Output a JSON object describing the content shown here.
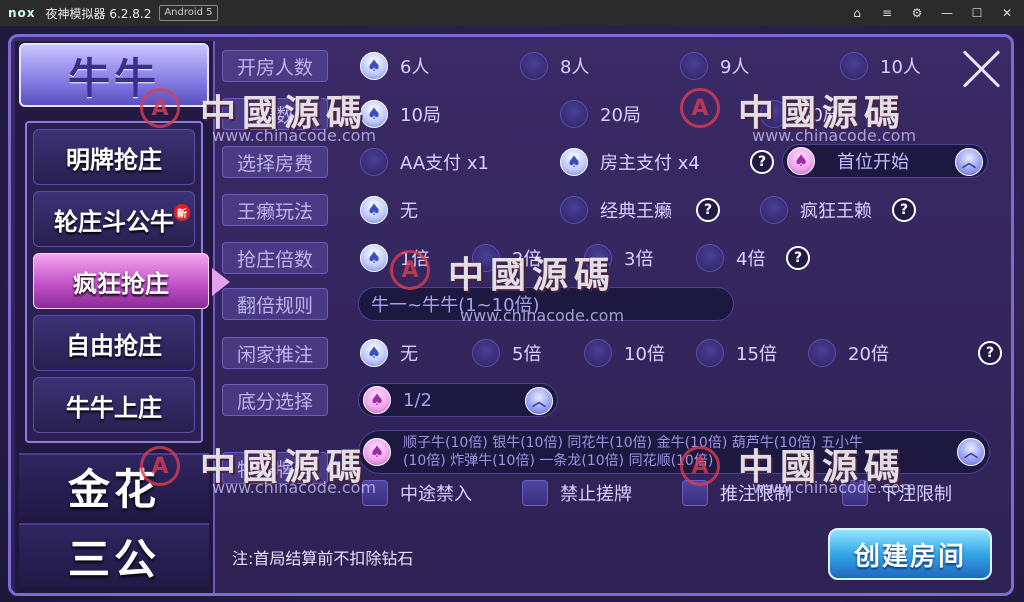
{
  "titlebar": {
    "logo": "nox",
    "title": "夜神模拟器 6.2.8.2",
    "android": "Android 5",
    "controls": [
      "⌂",
      "≡",
      "⚙",
      "—",
      "☐",
      "✕"
    ]
  },
  "left": {
    "big_tabs": [
      "牛牛",
      "金花",
      "三公"
    ],
    "sub_items": [
      "明牌抢庄",
      "轮庄斗公牛",
      "疯狂抢庄",
      "自由抢庄",
      "牛牛上庄"
    ],
    "new_badge": "新"
  },
  "rows": {
    "players": {
      "label": "开房人数",
      "options": [
        "6人",
        "8人",
        "9人",
        "10人"
      ]
    },
    "rounds": {
      "label": "局数",
      "options": [
        "10局",
        "20局",
        "30局"
      ]
    },
    "fee": {
      "label": "选择房费",
      "options": [
        "AA支付 x1",
        "房主支付 x4"
      ],
      "start_pill": "首位开始"
    },
    "wild": {
      "label": "王癞玩法",
      "options": [
        "无",
        "经典王癞",
        "疯狂王赖"
      ]
    },
    "grab": {
      "label": "抢庄倍数",
      "options": [
        "1倍",
        "2倍",
        "3倍",
        "4倍"
      ]
    },
    "double": {
      "label": "翻倍规则",
      "value": "牛一~牛牛(1~10倍)"
    },
    "push": {
      "label": "闲家推注",
      "options": [
        "无",
        "5倍",
        "10倍",
        "15倍",
        "20倍"
      ]
    },
    "base": {
      "label": "底分选择",
      "value": "1/2"
    },
    "special": {
      "label": "特殊牌型",
      "value_line1": "顺子牛(10倍)  银牛(10倍)  同花牛(10倍)  金牛(10倍)  葫芦牛(10倍)  五小牛",
      "value_line2": "(10倍)  炸弹牛(10倍)  一条龙(10倍)  同花顺(10倍)"
    },
    "checks": [
      "中途禁入",
      "禁止搓牌",
      "推注限制",
      "下注限制"
    ]
  },
  "note": "注:首局结算前不扣除钻石",
  "create_button": "创建房间",
  "watermark": {
    "text": "中國源碼",
    "url": "www.chinacode.com"
  }
}
